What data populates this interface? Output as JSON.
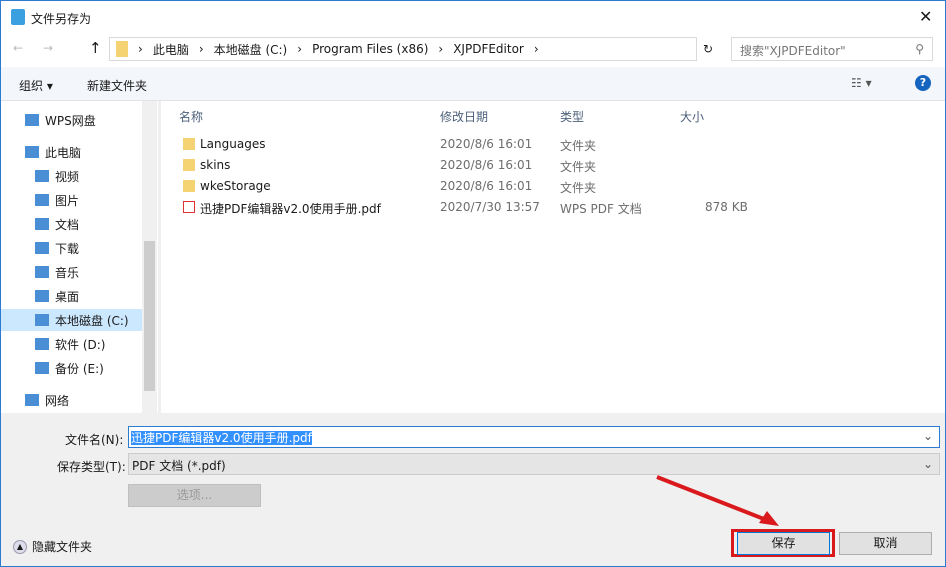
{
  "title": "文件另存为",
  "nav": {
    "path": [
      "此电脑",
      "本地磁盘 (C:)",
      "Program Files (x86)",
      "XJPDFEditor"
    ],
    "search_placeholder": "搜索\"XJPDFEditor\""
  },
  "toolbar": {
    "organize": "组织 ▾",
    "new_folder": "新建文件夹",
    "help": "?"
  },
  "sidebar": [
    {
      "label": "WPS网盘",
      "icon": "cloud-icon"
    },
    {
      "label": "此电脑",
      "icon": "computer-icon"
    },
    {
      "label": "视频",
      "icon": "video-icon"
    },
    {
      "label": "图片",
      "icon": "picture-icon"
    },
    {
      "label": "文档",
      "icon": "document-icon"
    },
    {
      "label": "下载",
      "icon": "download-icon"
    },
    {
      "label": "音乐",
      "icon": "music-icon"
    },
    {
      "label": "桌面",
      "icon": "desktop-icon"
    },
    {
      "label": "本地磁盘 (C:)",
      "icon": "drive-icon"
    },
    {
      "label": "软件 (D:)",
      "icon": "drive-icon"
    },
    {
      "label": "备份 (E:)",
      "icon": "drive-icon"
    },
    {
      "label": "网络",
      "icon": "network-icon"
    }
  ],
  "columns": [
    "名称",
    "修改日期",
    "类型",
    "大小"
  ],
  "files": [
    {
      "name": "Languages",
      "date": "2020/8/6 16:01",
      "type": "文件夹",
      "size": ""
    },
    {
      "name": "skins",
      "date": "2020/8/6 16:01",
      "type": "文件夹",
      "size": ""
    },
    {
      "name": "wkeStorage",
      "date": "2020/8/6 16:01",
      "type": "文件夹",
      "size": ""
    },
    {
      "name": "迅捷PDF编辑器v2.0使用手册.pdf",
      "date": "2020/7/30 13:57",
      "type": "WPS PDF 文档",
      "size": "878 KB"
    }
  ],
  "form": {
    "filename_label": "文件名(N):",
    "filename": "迅捷PDF编辑器v2.0使用手册.pdf",
    "type_label": "保存类型(T):",
    "type": "PDF 文档 (*.pdf)",
    "options": "选项..."
  },
  "footer": {
    "hide_folders": "隐藏文件夹",
    "save": "保存",
    "cancel": "取消"
  },
  "accent": "#2b7bd0",
  "highlight": "#d9191c"
}
